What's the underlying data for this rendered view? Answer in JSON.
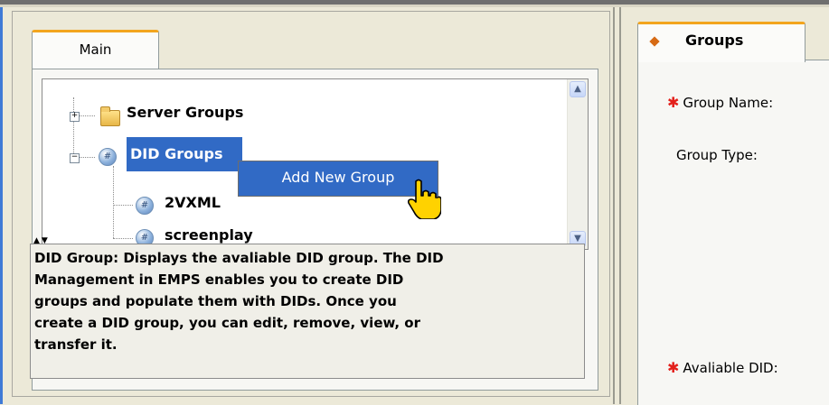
{
  "left_tabs": {
    "main_label": "Main"
  },
  "tree": {
    "server_groups": "Server Groups",
    "did_groups": "DID Groups",
    "children": [
      "2VXML",
      "screenplay"
    ]
  },
  "context_menu": {
    "add_new_group": "Add New Group"
  },
  "description": "DID Group: Displays the avaliable DID group. The DID Management in EMPS enables you to create DID groups and populate them with DIDs. Once you create a DID group, you can edit, remove, view, or transfer it.",
  "description_lines": [
    "DID Group: Displays the avaliable DID group. The DID",
    "Management in EMPS enables you to create DID",
    "groups and populate them with DIDs. Once you",
    "create a DID group, you can edit, remove, view, or",
    "transfer it."
  ],
  "right_tabs": {
    "groups_label": "Groups"
  },
  "form": {
    "group_name_label": "Group Name:",
    "group_type_label": "Group Type:",
    "available_did_label": "Avaliable DID:"
  },
  "icons": {
    "expand": "plus-box-icon",
    "collapse": "minus-box-icon",
    "folder": "folder-icon",
    "did": "globe-icon",
    "hand": "hand-pointer-icon"
  },
  "colors": {
    "selection": "#316ac5",
    "tab_accent": "#f3a51e",
    "required": "#e3201b"
  }
}
